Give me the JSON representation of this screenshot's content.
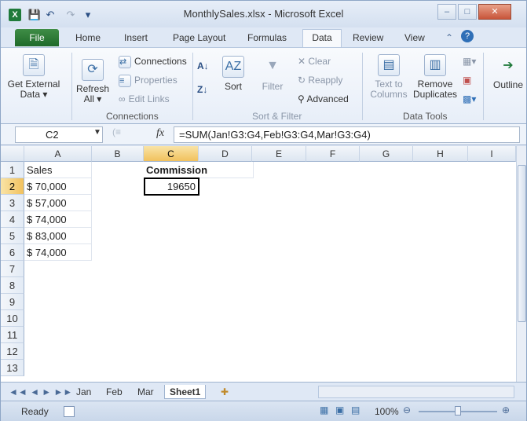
{
  "window": {
    "title": "MonthlySales.xlsx - Microsoft Excel",
    "minimize": "–",
    "maximize": "□",
    "close": "✕"
  },
  "ribbon_tabs": [
    "File",
    "Home",
    "Insert",
    "Page Layout",
    "Formulas",
    "Data",
    "Review",
    "View"
  ],
  "ribbon": {
    "get_external": "Get External\nData ▾",
    "refresh": "Refresh\nAll ▾",
    "connections": "Connections",
    "properties": "Properties",
    "edit_links": "Edit Links",
    "group_connections": "Connections",
    "sort": "Sort",
    "filter": "Filter",
    "clear": "Clear",
    "reapply": "Reapply",
    "advanced": "Advanced",
    "group_sort_filter": "Sort & Filter",
    "text_to_columns": "Text to\nColumns",
    "remove_duplicates": "Remove\nDuplicates",
    "group_data_tools": "Data Tools",
    "outline": "Outline"
  },
  "formula_bar": {
    "name_box": "C2",
    "fx": "fx",
    "formula": "=SUM(Jan!G3:G4,Feb!G3:G4,Mar!G3:G4)"
  },
  "columns": [
    "A",
    "B",
    "C",
    "D",
    "E",
    "F",
    "G",
    "H",
    "I"
  ],
  "rows": [
    "1",
    "2",
    "3",
    "4",
    "5",
    "6",
    "7",
    "8",
    "9",
    "10",
    "11",
    "12",
    "13"
  ],
  "cells": {
    "A1": "Sales",
    "C1": "Commission",
    "A2": "$ 70,000",
    "C2": "19650",
    "A3": "$ 57,000",
    "A4": "$ 74,000",
    "A5": "$ 83,000",
    "A6": "$ 74,000"
  },
  "sheets": [
    "Jan",
    "Feb",
    "Mar",
    "Sheet1"
  ],
  "status": {
    "ready": "Ready",
    "zoom": "100%"
  }
}
